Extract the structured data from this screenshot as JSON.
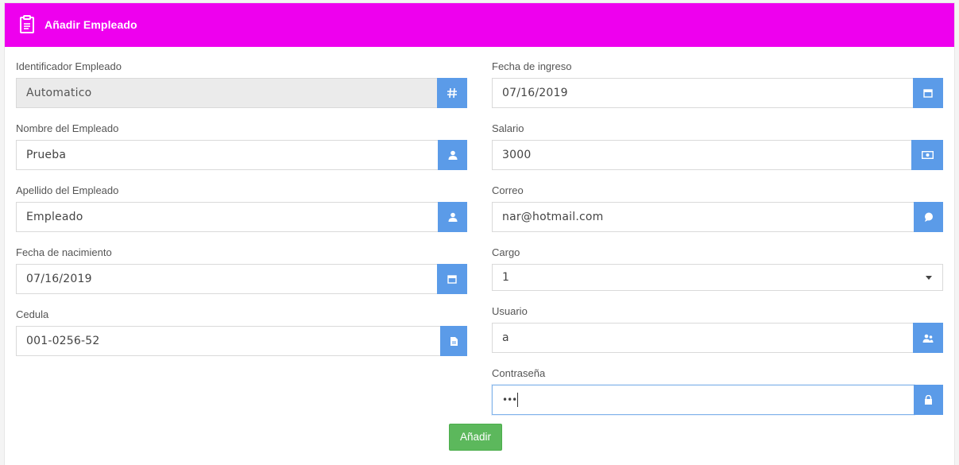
{
  "header": {
    "title": "Añadir Empleado",
    "icon": "clipboard-icon",
    "color": "#ee00ee"
  },
  "left": {
    "id": {
      "label": "Identificador Empleado",
      "value": "Automatico",
      "icon": "hash-icon"
    },
    "nombre": {
      "label": "Nombre del Empleado",
      "value": "Prueba",
      "icon": "user-icon"
    },
    "apellido": {
      "label": "Apellido del Empleado",
      "value": "Empleado",
      "icon": "user-icon"
    },
    "nacimiento": {
      "label": "Fecha de nacimiento",
      "value": "07/16/2019",
      "icon": "calendar-icon"
    },
    "cedula": {
      "label": "Cedula",
      "value": "001-0256-52",
      "icon": "document-icon"
    }
  },
  "right": {
    "ingreso": {
      "label": "Fecha de ingreso",
      "value": "07/16/2019",
      "icon": "calendar-icon"
    },
    "salario": {
      "label": "Salario",
      "value": "3000",
      "icon": "money-icon"
    },
    "correo": {
      "label": "Correo",
      "value": "nar@hotmail.com",
      "icon": "chat-bubble-icon"
    },
    "cargo": {
      "label": "Cargo",
      "value": "1"
    },
    "usuario": {
      "label": "Usuario",
      "value": "a",
      "icon": "users-icon"
    },
    "password": {
      "label": "Contraseña",
      "value": "•••",
      "icon": "lock-icon"
    }
  },
  "actions": {
    "submit_label": "Añadir",
    "submit_color": "#5cb85c"
  },
  "colors": {
    "addon": "#5b9be8",
    "readonly_bg": "#ebebeb"
  }
}
